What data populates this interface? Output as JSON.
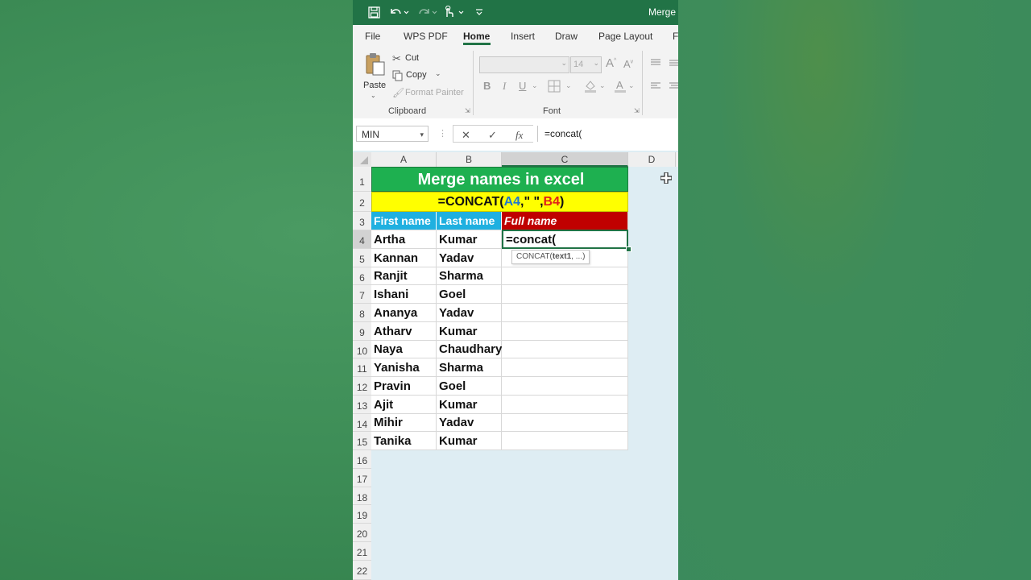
{
  "window": {
    "title": "Merge r",
    "quick_access": [
      "save-icon",
      "undo-icon",
      "redo-icon",
      "touch-mode-icon",
      "customize-icon"
    ]
  },
  "tabs": [
    {
      "label": "File"
    },
    {
      "label": "WPS PDF"
    },
    {
      "label": "Home"
    },
    {
      "label": "Insert"
    },
    {
      "label": "Draw"
    },
    {
      "label": "Page Layout"
    },
    {
      "label": "F"
    }
  ],
  "ribbon": {
    "clipboard": {
      "paste": "Paste",
      "cut": "Cut",
      "copy": "Copy",
      "format_painter": "Format Painter",
      "group_label": "Clipboard"
    },
    "font": {
      "font_name": "",
      "font_size": "14",
      "grow": "A",
      "shrink": "A",
      "bold": "B",
      "italic": "I",
      "underline": "U",
      "color_letter": "A",
      "group_label": "Font"
    }
  },
  "formula_bar": {
    "name_box": "MIN",
    "cancel": "✕",
    "enter": "✓",
    "fx": "fx",
    "content": "=concat("
  },
  "columns": [
    "A",
    "B",
    "C",
    "D"
  ],
  "rows": [
    "1",
    "2",
    "3",
    "4",
    "5",
    "6",
    "7",
    "8",
    "9",
    "10",
    "11",
    "12",
    "13",
    "14",
    "15",
    "16",
    "17",
    "18",
    "19",
    "20",
    "21",
    "22"
  ],
  "sheet": {
    "title": "Merge names in excel",
    "formula_text": {
      "prefix": "=CONCAT(",
      "ref1": "A4",
      "sep": ",\" \",",
      "ref2": "B4",
      "suffix": ")"
    },
    "headers": {
      "first": "First name",
      "last": "Last name",
      "full": "Full name"
    },
    "data": [
      {
        "first": "Artha",
        "last": "Kumar",
        "full": "=concat("
      },
      {
        "first": "Kannan",
        "last": "Yadav",
        "full": ""
      },
      {
        "first": "Ranjit",
        "last": "Sharma",
        "full": ""
      },
      {
        "first": "Ishani",
        "last": "Goel",
        "full": ""
      },
      {
        "first": "Ananya",
        "last": "Yadav",
        "full": ""
      },
      {
        "first": "Atharv",
        "last": "Kumar",
        "full": ""
      },
      {
        "first": "Naya",
        "last": "Chaudhary",
        "full": ""
      },
      {
        "first": "Yanisha",
        "last": "Sharma",
        "full": ""
      },
      {
        "first": "Pravin",
        "last": "Goel",
        "full": ""
      },
      {
        "first": "Ajit",
        "last": "Kumar",
        "full": ""
      },
      {
        "first": "Mihir",
        "last": "Yadav",
        "full": ""
      },
      {
        "first": "Tanika",
        "last": "Kumar",
        "full": ""
      }
    ],
    "tooltip": {
      "fn": "CONCAT(",
      "arg": "text1",
      "rest": ", ...)"
    }
  },
  "colors": {
    "excel_green": "#217346",
    "title_fill": "#1eb050",
    "formula_fill": "#ffff00",
    "header_fill": "#1fb0e0",
    "full_fill": "#c00000",
    "ref1_color": "#1f77d0",
    "ref2_color": "#e0201a"
  }
}
